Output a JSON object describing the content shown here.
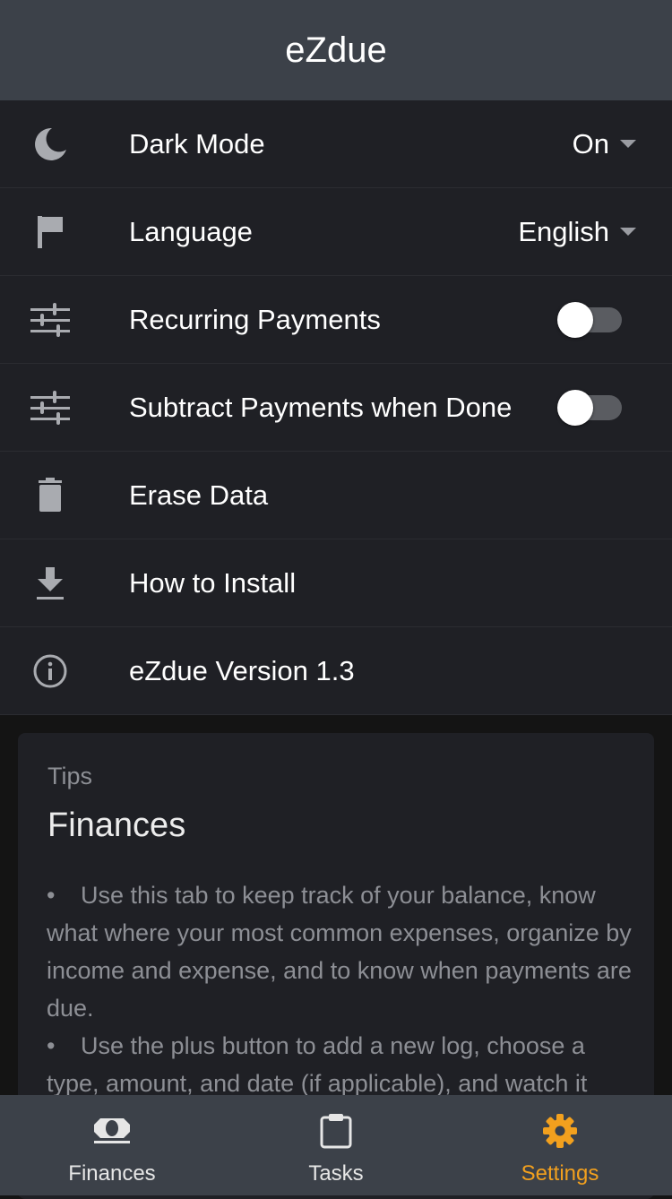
{
  "app": {
    "title": "eZdue"
  },
  "settings": {
    "dark_mode": {
      "label": "Dark Mode",
      "value": "On",
      "icon": "moon-icon"
    },
    "language": {
      "label": "Language",
      "value": "English",
      "icon": "flag-icon"
    },
    "recurring": {
      "label": "Recurring Payments",
      "enabled": false,
      "icon": "sliders-icon"
    },
    "subtract": {
      "label": "Subtract Payments when Done",
      "enabled": false,
      "icon": "sliders-icon"
    },
    "erase": {
      "label": "Erase Data",
      "icon": "trash-icon"
    },
    "install": {
      "label": "How to Install",
      "icon": "download-icon"
    },
    "version": {
      "label": "eZdue Version 1.3",
      "icon": "info-icon"
    }
  },
  "tips": {
    "caption": "Tips",
    "heading": "Finances",
    "bullets": [
      "Use this tab to keep track of your balance, know what where your most common expenses, organize by income and expense, and to know when payments are due.",
      "Use the plus button to add a new log, choose a type, amount, and date (if applicable), and watch it"
    ],
    "bullet_char": "•"
  },
  "nav": {
    "items": [
      {
        "label": "Finances",
        "icon": "money-icon",
        "active": false
      },
      {
        "label": "Tasks",
        "icon": "clipboard-icon",
        "active": false
      },
      {
        "label": "Settings",
        "icon": "gear-icon",
        "active": true
      }
    ]
  },
  "colors": {
    "accent": "#f2a01e",
    "header_bg": "#3c4149",
    "row_bg": "#1f2025",
    "page_bg": "#141414"
  }
}
